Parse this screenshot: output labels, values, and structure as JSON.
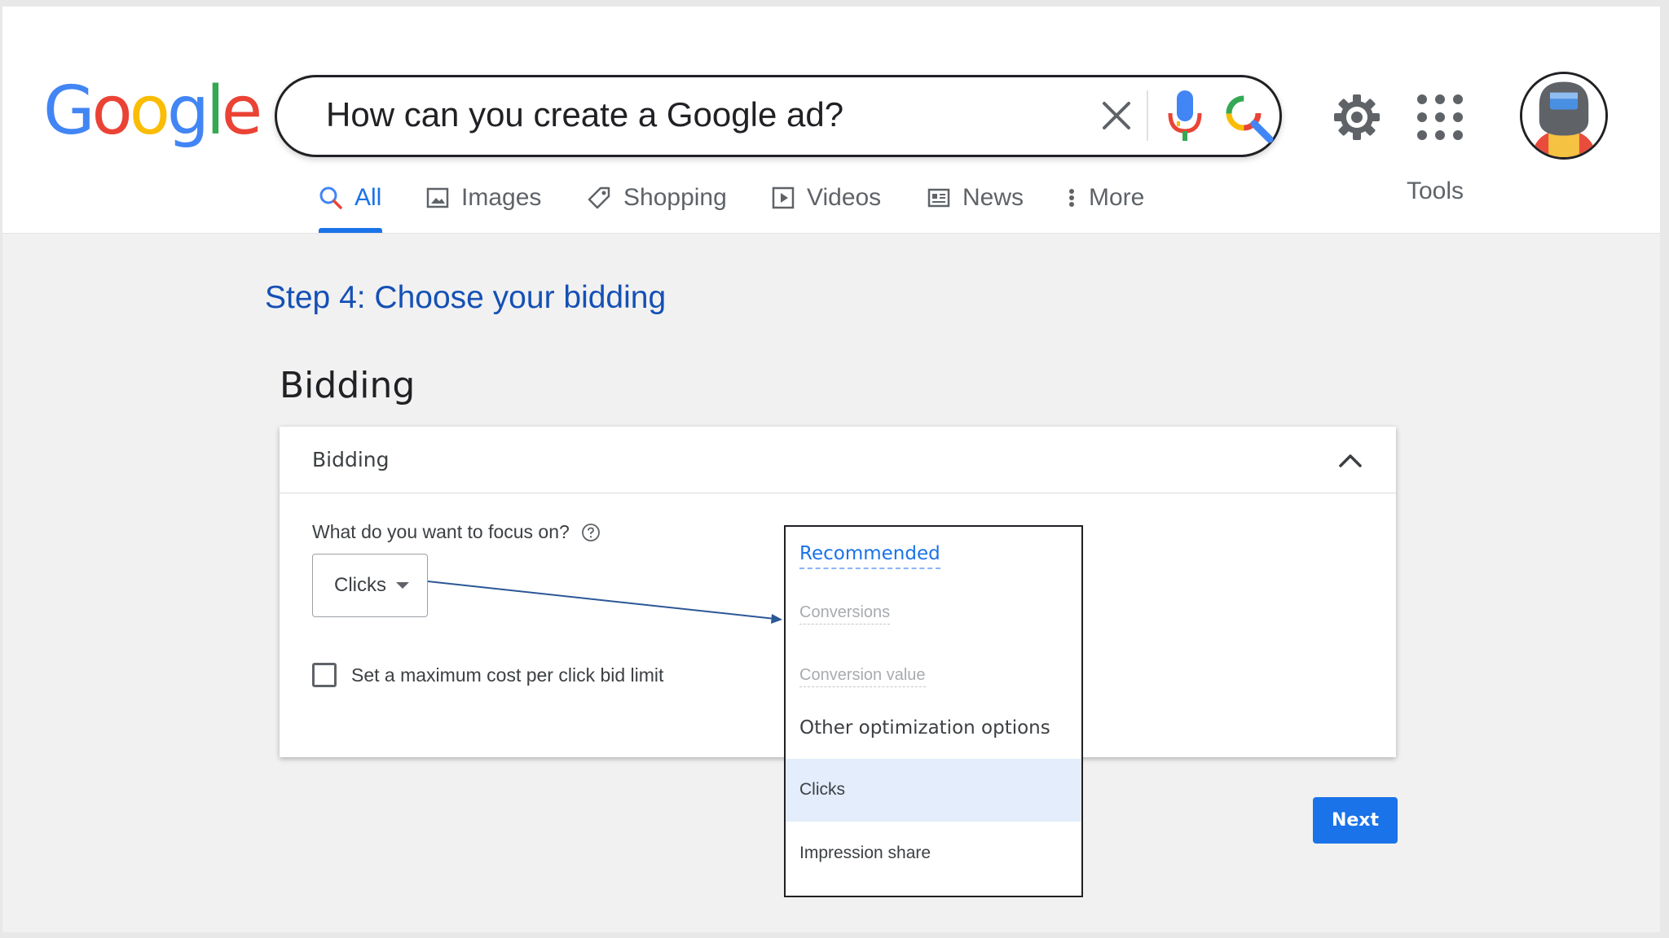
{
  "search": {
    "query": "How can you create a Google ad?"
  },
  "logo": {
    "letters": [
      "G",
      "o",
      "o",
      "g",
      "l",
      "e"
    ],
    "colors": [
      "#4285f4",
      "#ea4335",
      "#fbbc05",
      "#4285f4",
      "#34a853",
      "#ea4335"
    ]
  },
  "tabs": [
    {
      "label": "All",
      "icon": "search-icon",
      "active": true
    },
    {
      "label": "Images",
      "icon": "image-icon"
    },
    {
      "label": "Shopping",
      "icon": "tag-icon"
    },
    {
      "label": "Videos",
      "icon": "play-icon"
    },
    {
      "label": "News",
      "icon": "newspaper-icon"
    },
    {
      "label": "More",
      "icon": "more-vert-icon"
    }
  ],
  "tools_label": "Tools",
  "step_title": "Step 4: Choose your bidding",
  "section_title": "Bidding",
  "card": {
    "title": "Bidding",
    "question": "What do you want to focus on?",
    "select_value": "Clicks",
    "checkbox_label": "Set a maximum cost per click bid limit"
  },
  "dropdown": {
    "recommended": "Recommended",
    "conversions": "Conversions",
    "conversion_value": "Conversion value",
    "other_options": "Other optimization options",
    "clicks": "Clicks",
    "impression_share": "Impression share"
  },
  "next_label": "Next",
  "colors": {
    "accent": "#1a73e8",
    "step_title": "#1550b5",
    "selected_bg": "#e3edfb"
  }
}
